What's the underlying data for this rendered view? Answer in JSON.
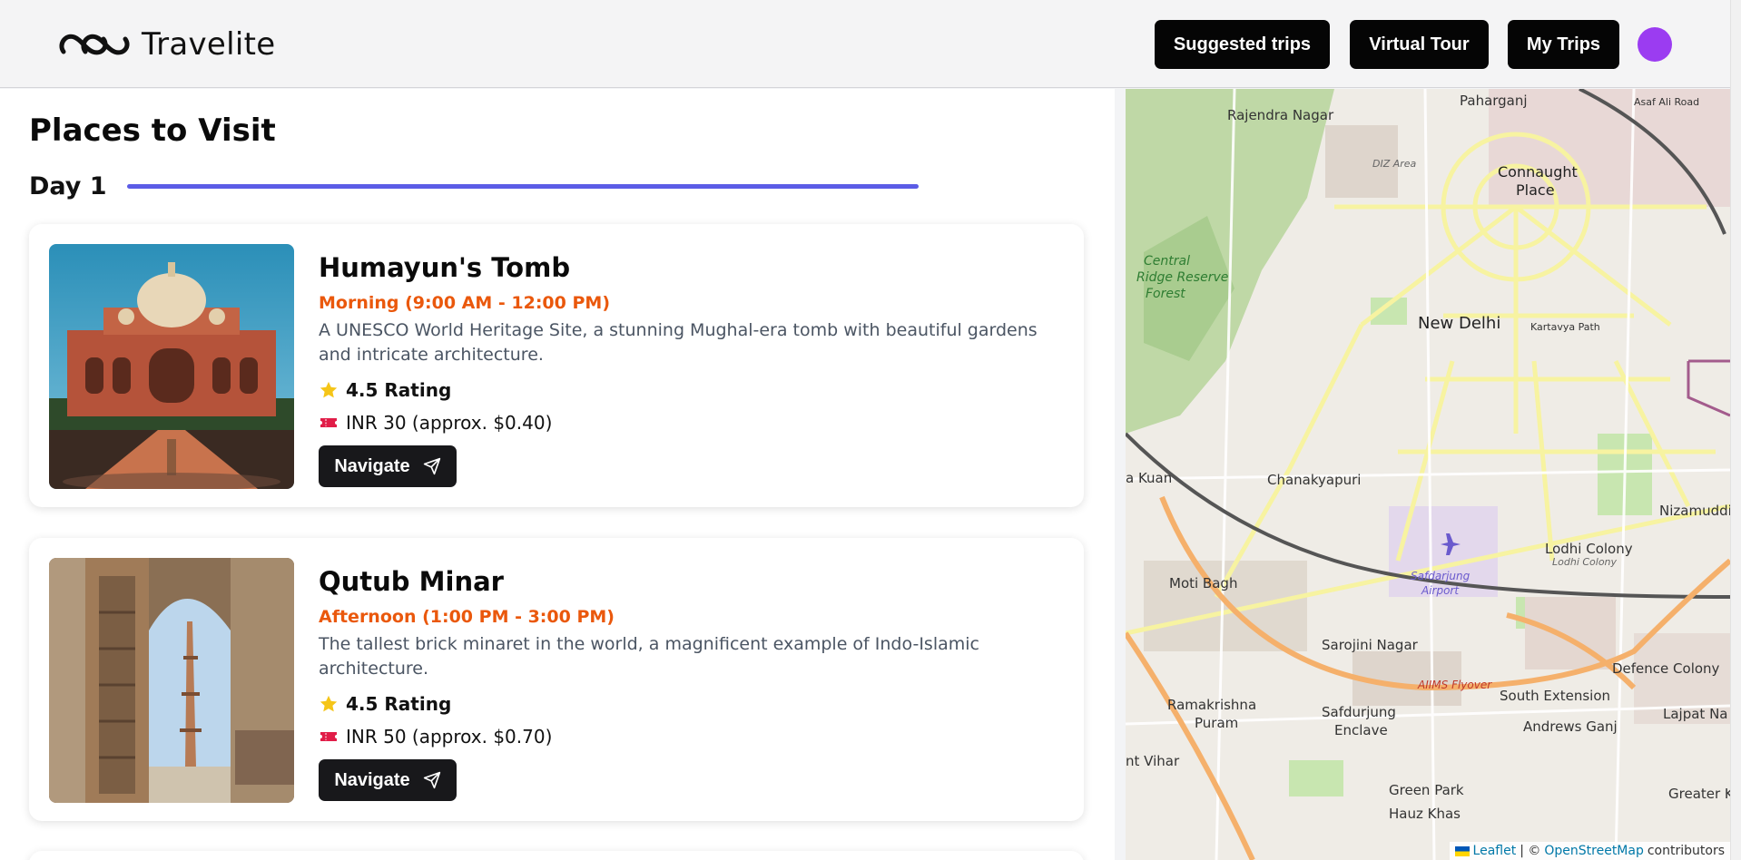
{
  "header": {
    "brand": "Travelite",
    "nav": {
      "suggested": "Suggested trips",
      "virtual": "Virtual Tour",
      "mytrips": "My Trips"
    },
    "avatar_color": "#9b3cf1"
  },
  "main": {
    "title": "Places to Visit",
    "day_label": "Day 1",
    "accent_color": "#5b5ce6",
    "places": [
      {
        "name": "Humayun's Tomb",
        "time": "Morning (9:00 AM - 12:00 PM)",
        "description": "A UNESCO World Heritage Site, a stunning Mughal-era tomb with beautiful gardens and intricate architecture.",
        "rating": "4.5 Rating",
        "price": "INR 30 (approx. $0.40)",
        "navigate": "Navigate"
      },
      {
        "name": "Qutub Minar",
        "time": "Afternoon (1:00 PM - 3:00 PM)",
        "description": "The tallest brick minaret in the world, a magnificent example of Indo-Islamic architecture.",
        "rating": "4.5 Rating",
        "price": "INR 50 (approx. $0.70)",
        "navigate": "Navigate"
      }
    ]
  },
  "map": {
    "labels": {
      "rajendra": "Rajendra Nagar",
      "paharganj": "Paharganj",
      "asaf": "Asaf Ali Road",
      "connaught": "Connaught",
      "place": "Place",
      "diz": "DIZ Area",
      "central1": "Central",
      "central2": "Ridge Reserve",
      "central3": "Forest",
      "newdelhi": "New Delhi",
      "kartavya": "Kartavya Path",
      "kuan": "a Kuan",
      "chanakyapuri": "Chanakyapuri",
      "nizamuddin": "Nizamuddi",
      "lodhi1": "Lodhi Colony",
      "lodhi2": "Lodhi Colony",
      "motibagh": "Moti Bagh",
      "safdarjung_airport1": "Safdarjung",
      "safdarjung_airport2": "Airport",
      "sarojini": "Sarojini Nagar",
      "defence": "Defence Colony",
      "aiims": "AIIMS Flyover",
      "southext": "South Extension",
      "lajpat": "Lajpat Na",
      "rk1": "Ramakrishna",
      "rk2": "Puram",
      "sfj1": "Safdurjung",
      "sfj2": "Enclave",
      "andrews": "Andrews Ganj",
      "vihar": "nt Vihar",
      "greenpark": "Green Park",
      "greaterk": "Greater Ka",
      "hauz": "Hauz Khas"
    },
    "attribution": {
      "leaflet": "Leaflet",
      "sep": "| ©",
      "osm": "OpenStreetMap",
      "contrib": "contributors"
    }
  }
}
